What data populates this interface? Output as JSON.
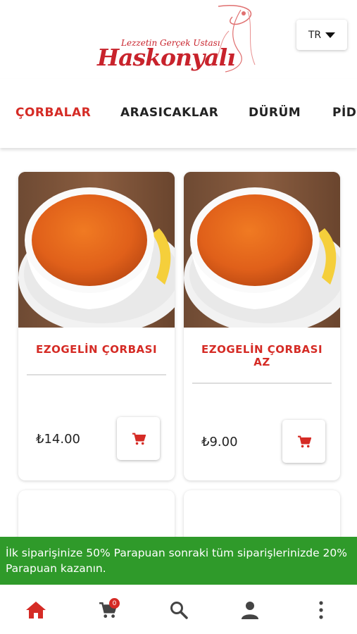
{
  "brand": {
    "tagline": "Lezzetin Gerçek Ustası",
    "name": "Haskonyalı"
  },
  "language": {
    "current": "TR"
  },
  "categories": [
    {
      "label": "ÇORBALAR",
      "active": true
    },
    {
      "label": "ARASICAKLAR",
      "active": false
    },
    {
      "label": "DÜRÜM",
      "active": false
    },
    {
      "label": "PİDE",
      "active": false
    }
  ],
  "products": [
    {
      "name": "EZOGELİN ÇORBASI",
      "price": "₺14.00",
      "image": "lentil-soup-bowl"
    },
    {
      "name": "EZOGELİN ÇORBASI AZ",
      "price": "₺9.00",
      "image": "lentil-soup-bowl"
    }
  ],
  "promo": {
    "text": "İlk siparişinize 50% Parapuan sonraki tüm siparişlerinizde 20% Parapuan kazanın."
  },
  "bottom_nav": {
    "cart_count": "0",
    "items": [
      "home-icon",
      "cart-icon",
      "search-icon",
      "user-icon",
      "more-icon"
    ]
  },
  "colors": {
    "accent": "#d52b25",
    "promo_bg": "#2f9a2a",
    "brand": "#c8232c"
  }
}
